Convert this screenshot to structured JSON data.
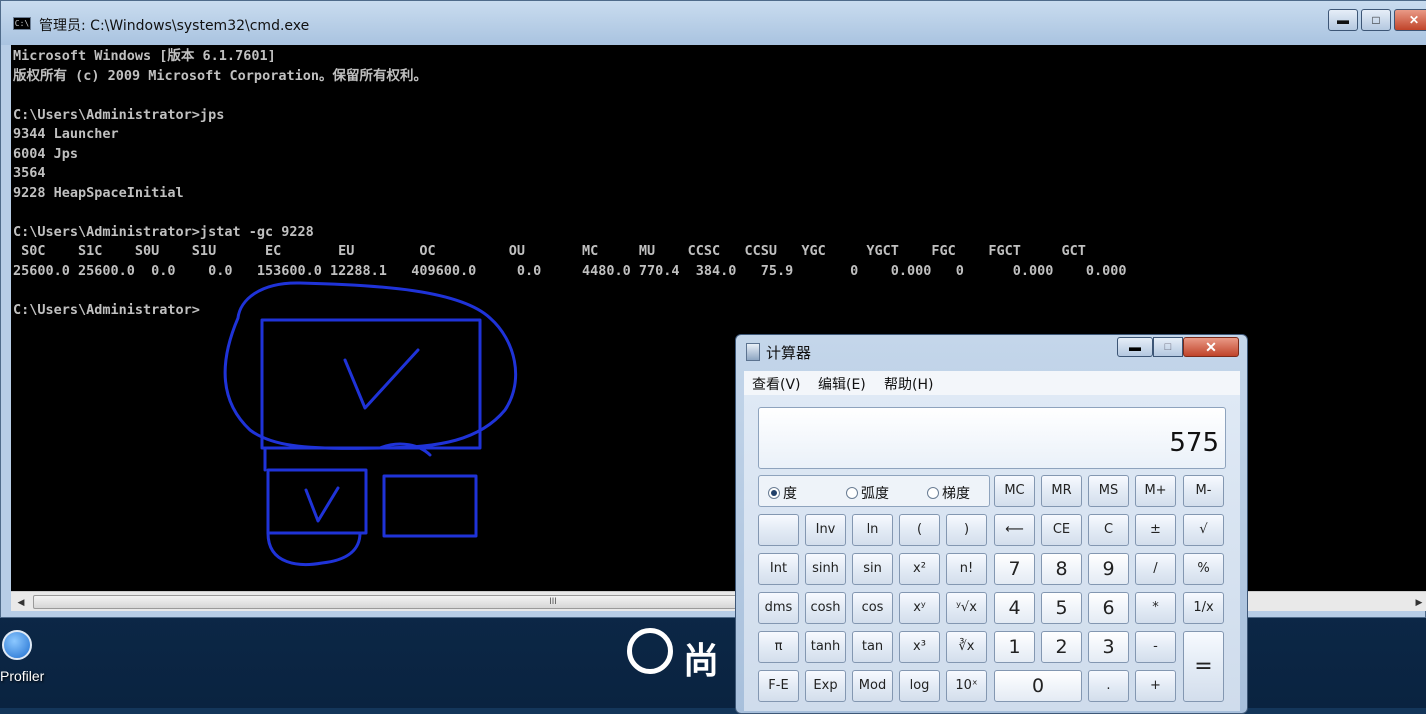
{
  "cmd_window": {
    "title": "管理员: C:\\Windows\\system32\\cmd.exe",
    "icon": "cmd-icon",
    "buttons": {
      "minimize": "▬",
      "maximize": "□",
      "close": "✕"
    },
    "console_lines": [
      "Microsoft Windows [版本 6.1.7601]",
      "版权所有 (c) 2009 Microsoft Corporation。保留所有权利。",
      "",
      "C:\\Users\\Administrator>jps",
      "9344 Launcher",
      "6004 Jps",
      "3564",
      "9228 HeapSpaceInitial",
      "",
      "C:\\Users\\Administrator>jstat -gc 9228",
      " S0C    S1C    S0U    S1U      EC       EU        OC         OU       MC     MU    CCSC   CCSU   YGC     YGCT    FGC    FGCT     GCT",
      "25600.0 25600.0  0.0    0.0   153600.0 12288.1   409600.0     0.0     4480.0 770.4  384.0   75.9       0    0.000   0      0.000    0.000",
      "",
      "C:\\Users\\Administrator>"
    ],
    "scrollbar": {
      "left": "◀",
      "grip": "III",
      "right": "▶"
    }
  },
  "desktop": {
    "profiler_label": "Profiler",
    "logo_text": "尚"
  },
  "calculator": {
    "title": "计算器",
    "title_buttons": {
      "minimize": "▬",
      "maximize": "□",
      "close": "✕"
    },
    "menu": [
      "查看(V)",
      "编辑(E)",
      "帮助(H)"
    ],
    "display": "575",
    "angle_modes": [
      {
        "label": "度",
        "selected": true
      },
      {
        "label": "弧度",
        "selected": false
      },
      {
        "label": "梯度",
        "selected": false
      }
    ],
    "memory": [
      "MC",
      "MR",
      "MS",
      "M+",
      "M-"
    ],
    "row1": [
      "",
      "Inv",
      "ln",
      "(",
      ")",
      "⟵",
      "CE",
      "C",
      "±",
      "√"
    ],
    "row2": [
      "Int",
      "sinh",
      "sin",
      "x²",
      "n!",
      "7",
      "8",
      "9",
      "/",
      "%"
    ],
    "row3": [
      "dms",
      "cosh",
      "cos",
      "xʸ",
      "ʸ√x",
      "4",
      "5",
      "6",
      "*",
      "1/x"
    ],
    "row4": [
      "π",
      "tanh",
      "tan",
      "x³",
      "∛x",
      "1",
      "2",
      "3",
      "-",
      "="
    ],
    "row5": [
      "F-E",
      "Exp",
      "Mod",
      "log",
      "10ˣ",
      "0",
      ".",
      "+"
    ]
  },
  "annotations": {
    "checkmark": "✓",
    "color": "#1f33d8"
  }
}
